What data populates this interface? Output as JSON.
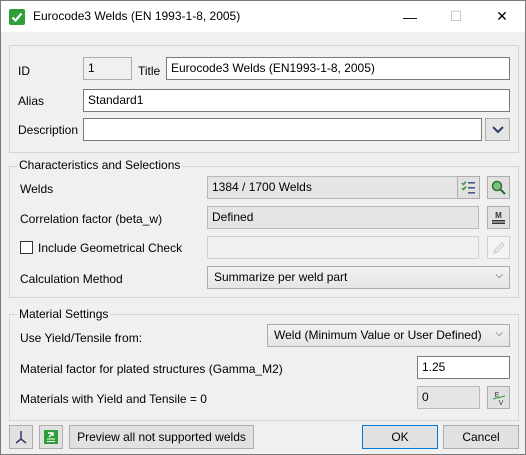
{
  "window": {
    "title": "Eurocode3 Welds (EN 1993-1-8, 2005)",
    "controls": {
      "minimize": "—",
      "maximize": "☐",
      "close": "✕"
    }
  },
  "general": {
    "id_label": "ID",
    "id_value": "1",
    "title_label": "Title",
    "title_value": "Eurocode3 Welds (EN1993-1-8, 2005)",
    "alias_label": "Alias",
    "alias_value": "Standard1",
    "description_label": "Description",
    "description_value": ""
  },
  "characteristics": {
    "group_title": "Characteristics and Selections",
    "welds_label": "Welds",
    "welds_value": "1384 / 1700 Welds",
    "correlation_label": "Correlation factor (beta_w)",
    "correlation_value": "Defined",
    "geometrical_check_label": "Include Geometrical Check",
    "geometrical_check_checked": false,
    "geometrical_check_value": "",
    "calc_method_label": "Calculation Method",
    "calc_method_value": "Summarize per weld part"
  },
  "material": {
    "group_title": "Material Settings",
    "yield_label": "Use Yield/Tensile from:",
    "yield_value": "Weld (Minimum Value or User Defined)",
    "gamma_label": "Material factor for plated structures (Gamma_M2)",
    "gamma_value": "1.25",
    "zero_label": "Materials with Yield and Tensile = 0",
    "zero_value": "0"
  },
  "footer": {
    "preview_label": "Preview all not supported welds",
    "ok_label": "OK",
    "cancel_label": "Cancel"
  },
  "colors": {
    "accent": "#0078d7",
    "check_green": "#2e9e3a",
    "icon_blue": "#4a5a8a"
  }
}
